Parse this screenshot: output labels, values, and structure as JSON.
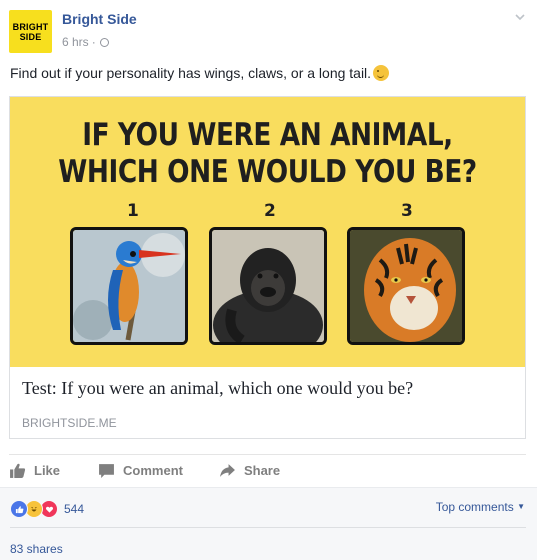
{
  "page": {
    "name": "Bright Side",
    "logo_line1": "BRIGHT",
    "logo_line2": "SIDE"
  },
  "meta": {
    "time": "6 hrs",
    "separator": "·"
  },
  "post": {
    "text": "Find out if your personality has wings, claws, or a long tail."
  },
  "card": {
    "image_headline_line1": "IF YOU WERE AN ANIMAL,",
    "image_headline_line2": "WHICH ONE WOULD YOU BE?",
    "numbers": [
      "1",
      "2",
      "3"
    ],
    "title": "Test: If you were an animal, which one would you be?",
    "domain": "BRIGHTSIDE.ME"
  },
  "actions": {
    "like": "Like",
    "comment": "Comment",
    "share": "Share"
  },
  "reactions": {
    "count": "544",
    "top_comments": "Top comments",
    "shares": "83 shares"
  },
  "colors": {
    "brand_yellow": "#f7df1e",
    "link_blue": "#365899",
    "image_bg": "#f9dd5e"
  }
}
